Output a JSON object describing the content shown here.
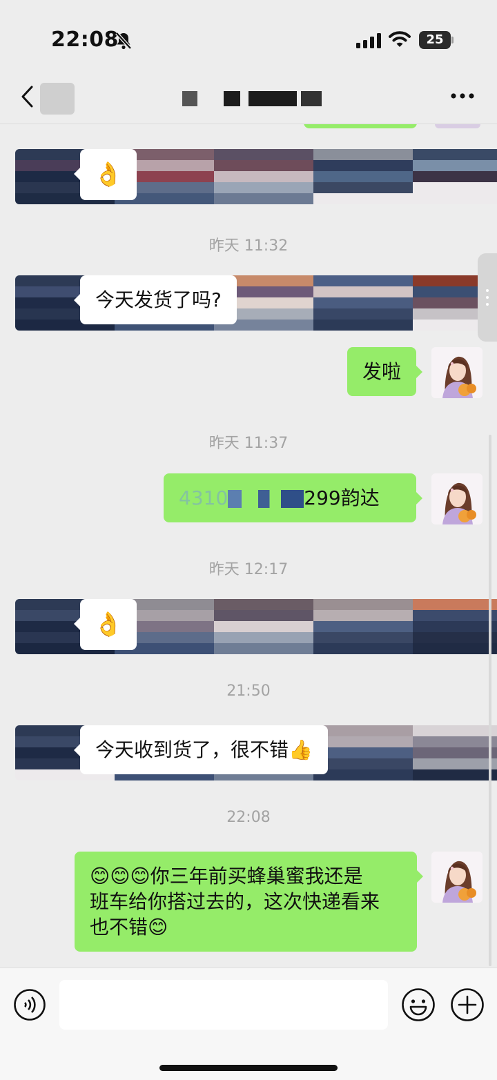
{
  "status_bar": {
    "time": "22:08",
    "battery": "25",
    "icons": [
      "bell-slash-icon",
      "cellular-signal-icon",
      "wifi-icon",
      "battery-icon"
    ]
  },
  "nav": {
    "icons": [
      "chevron-left-icon",
      "more-dots-icon"
    ]
  },
  "messages": [
    {
      "id": "m1",
      "side": "left",
      "type": "emoji",
      "emoji": "👌"
    },
    {
      "id": "t1",
      "type": "timestamp",
      "text": "昨天 11:32"
    },
    {
      "id": "m2",
      "side": "left",
      "type": "text",
      "text": "今天发货了吗?"
    },
    {
      "id": "m3",
      "side": "right",
      "type": "text",
      "text": "发啦"
    },
    {
      "id": "t2",
      "type": "timestamp",
      "text": "昨天 11:37"
    },
    {
      "id": "m4",
      "side": "right",
      "type": "text",
      "visible_prefix": "4310",
      "visible_suffix": "299韵达"
    },
    {
      "id": "t3",
      "type": "timestamp",
      "text": "昨天 12:17"
    },
    {
      "id": "m5",
      "side": "left",
      "type": "emoji",
      "emoji": "👌"
    },
    {
      "id": "t4",
      "type": "timestamp",
      "text": "21:50"
    },
    {
      "id": "m6",
      "side": "left",
      "type": "text",
      "text": "今天收到货了，很不错👍"
    },
    {
      "id": "t5",
      "type": "timestamp",
      "text": "22:08"
    },
    {
      "id": "m7",
      "side": "right",
      "type": "text",
      "lines": [
        "😊😊😊你三年前买蜂巢蜜我还是",
        "班车给你搭过去的，这次快递看来",
        "也不错😊"
      ]
    }
  ],
  "composer": {
    "value": "",
    "icons": [
      "voice-icon",
      "emoji-icon",
      "plus-icon"
    ]
  },
  "colors": {
    "background": "#ededed",
    "outgoing_bubble": "#95ec69",
    "incoming_bubble": "#ffffff",
    "timestamp_text": "#a3a3a3"
  }
}
